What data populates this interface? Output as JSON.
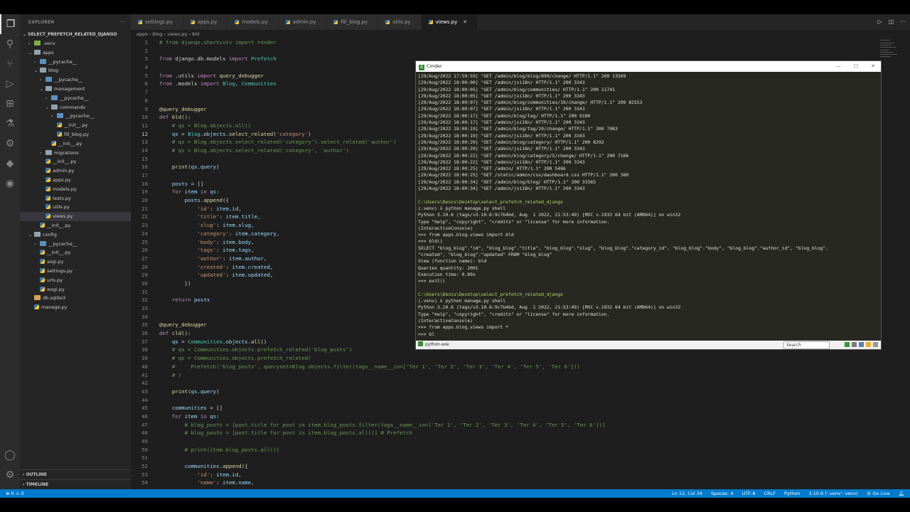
{
  "explorer": {
    "title": "EXPLORER",
    "project": "SELECT_PREFETCH_RELATED_DJANGO",
    "items": [
      {
        "label": ".venv",
        "indent": 1,
        "type": "venv",
        "chev": "›"
      },
      {
        "label": "apps",
        "indent": 1,
        "type": "folder",
        "chev": "⌄"
      },
      {
        "label": "__pycache__",
        "indent": 2,
        "type": "pyc",
        "chev": "›"
      },
      {
        "label": "blog",
        "indent": 2,
        "type": "folder",
        "chev": "⌄"
      },
      {
        "label": "__pycache__",
        "indent": 3,
        "type": "pyc",
        "chev": "›"
      },
      {
        "label": "management",
        "indent": 3,
        "type": "folder",
        "chev": "⌄"
      },
      {
        "label": "__pycache__",
        "indent": 4,
        "type": "pyc",
        "chev": "›"
      },
      {
        "label": "commands",
        "indent": 4,
        "type": "folder",
        "chev": "⌄"
      },
      {
        "label": "__pycache__",
        "indent": 5,
        "type": "pyc",
        "chev": "›"
      },
      {
        "label": "__init__.py",
        "indent": 5,
        "type": "py",
        "chev": ""
      },
      {
        "label": "fill_blog.py",
        "indent": 5,
        "type": "py",
        "chev": ""
      },
      {
        "label": "__init__.py",
        "indent": 4,
        "type": "py",
        "chev": ""
      },
      {
        "label": "migrations",
        "indent": 3,
        "type": "folder",
        "chev": "›"
      },
      {
        "label": "__init__.py",
        "indent": 3,
        "type": "py",
        "chev": ""
      },
      {
        "label": "admin.py",
        "indent": 3,
        "type": "py",
        "chev": ""
      },
      {
        "label": "apps.py",
        "indent": 3,
        "type": "py",
        "chev": ""
      },
      {
        "label": "models.py",
        "indent": 3,
        "type": "py",
        "chev": ""
      },
      {
        "label": "tests.py",
        "indent": 3,
        "type": "py",
        "chev": ""
      },
      {
        "label": "utils.py",
        "indent": 3,
        "type": "py",
        "chev": ""
      },
      {
        "label": "views.py",
        "indent": 3,
        "type": "py",
        "chev": "",
        "selected": true
      },
      {
        "label": "__init__.py",
        "indent": 2,
        "type": "py",
        "chev": ""
      },
      {
        "label": "config",
        "indent": 1,
        "type": "folder",
        "chev": "⌄"
      },
      {
        "label": "__pycache__",
        "indent": 2,
        "type": "pyc",
        "chev": "›"
      },
      {
        "label": "__init__.py",
        "indent": 2,
        "type": "py",
        "chev": ""
      },
      {
        "label": "asgi.py",
        "indent": 2,
        "type": "py",
        "chev": ""
      },
      {
        "label": "settings.py",
        "indent": 2,
        "type": "py",
        "chev": ""
      },
      {
        "label": "urls.py",
        "indent": 2,
        "type": "py",
        "chev": ""
      },
      {
        "label": "wsgi.py",
        "indent": 2,
        "type": "py",
        "chev": ""
      },
      {
        "label": "db.sqlite3",
        "indent": 1,
        "type": "db",
        "chev": ""
      },
      {
        "label": "manage.py",
        "indent": 1,
        "type": "py",
        "chev": ""
      }
    ],
    "outline": "OUTLINE",
    "timeline": "TIMELINE"
  },
  "tabs": [
    {
      "label": "settings.py",
      "active": false
    },
    {
      "label": "apps.py",
      "active": false
    },
    {
      "label": "models.py",
      "active": false
    },
    {
      "label": "admin.py",
      "active": false
    },
    {
      "label": "fill_blog.py",
      "active": false
    },
    {
      "label": "utils.py",
      "active": false
    },
    {
      "label": "views.py",
      "active": true
    }
  ],
  "breadcrumb": "apps › blog › views.py › bld",
  "code": [
    [
      [
        "cmt",
        "# from django.shortcuts import render"
      ]
    ],
    [],
    [
      [
        "kw",
        "from "
      ],
      [
        "code",
        "django.db.models "
      ],
      [
        "kw",
        "import "
      ],
      [
        "cls",
        "Prefetch"
      ]
    ],
    [],
    [
      [
        "kw",
        "from "
      ],
      [
        "code",
        ".utils "
      ],
      [
        "kw",
        "import "
      ],
      [
        "fn",
        "query_debugger"
      ]
    ],
    [
      [
        "kw",
        "from "
      ],
      [
        "code",
        ".models "
      ],
      [
        "kw",
        "import "
      ],
      [
        "cls",
        "Blog"
      ],
      [
        "code",
        ", "
      ],
      [
        "cls",
        "Communities"
      ]
    ],
    [],
    [],
    [
      [
        "dec",
        "@query_debugger"
      ]
    ],
    [
      [
        "kw",
        "def "
      ],
      [
        "fn",
        "bld"
      ],
      [
        "code",
        "():"
      ]
    ],
    [
      [
        "code",
        "    "
      ],
      [
        "cmt",
        "# qs = Blog.objects.all()"
      ]
    ],
    [
      [
        "code",
        "    "
      ],
      [
        "var",
        "qs"
      ],
      [
        "code",
        " = "
      ],
      [
        "cls",
        "Blog"
      ],
      [
        "code",
        "."
      ],
      [
        "var",
        "objects"
      ],
      [
        "code",
        "."
      ],
      [
        "fn",
        "select_related"
      ],
      [
        "code",
        "("
      ],
      [
        "str",
        "'category'"
      ],
      [
        "code",
        ")"
      ]
    ],
    [
      [
        "code",
        "    "
      ],
      [
        "cmt",
        "# qs = Blog.objects.select_related('category').select_related('author')"
      ]
    ],
    [
      [
        "code",
        "    "
      ],
      [
        "cmt",
        "# qs = Blog.objects.select_related('category', 'author')"
      ]
    ],
    [],
    [
      [
        "code",
        "    "
      ],
      [
        "fn",
        "print"
      ],
      [
        "code",
        "("
      ],
      [
        "var",
        "qs"
      ],
      [
        "code",
        "."
      ],
      [
        "var",
        "query"
      ],
      [
        "code",
        ")"
      ]
    ],
    [],
    [
      [
        "code",
        "    "
      ],
      [
        "var",
        "posts"
      ],
      [
        "code",
        " = []"
      ]
    ],
    [
      [
        "code",
        "    "
      ],
      [
        "kw",
        "for "
      ],
      [
        "var",
        "item"
      ],
      [
        "kw",
        " in "
      ],
      [
        "var",
        "qs"
      ],
      [
        "code",
        ":"
      ]
    ],
    [
      [
        "code",
        "        "
      ],
      [
        "var",
        "posts"
      ],
      [
        "code",
        "."
      ],
      [
        "fn",
        "append"
      ],
      [
        "code",
        "({"
      ]
    ],
    [
      [
        "code",
        "            "
      ],
      [
        "str",
        "'id'"
      ],
      [
        "code",
        ": "
      ],
      [
        "var",
        "item"
      ],
      [
        "code",
        "."
      ],
      [
        "var",
        "id"
      ],
      [
        "code",
        ","
      ]
    ],
    [
      [
        "code",
        "            "
      ],
      [
        "str",
        "'title'"
      ],
      [
        "code",
        ": "
      ],
      [
        "var",
        "item"
      ],
      [
        "code",
        "."
      ],
      [
        "var",
        "title"
      ],
      [
        "code",
        ","
      ]
    ],
    [
      [
        "code",
        "            "
      ],
      [
        "str",
        "'slug'"
      ],
      [
        "code",
        ": "
      ],
      [
        "var",
        "item"
      ],
      [
        "code",
        "."
      ],
      [
        "var",
        "slug"
      ],
      [
        "code",
        ","
      ]
    ],
    [
      [
        "code",
        "            "
      ],
      [
        "str",
        "'category'"
      ],
      [
        "code",
        ": "
      ],
      [
        "var",
        "item"
      ],
      [
        "code",
        "."
      ],
      [
        "var",
        "category"
      ],
      [
        "code",
        ","
      ]
    ],
    [
      [
        "code",
        "            "
      ],
      [
        "str",
        "'body'"
      ],
      [
        "code",
        ": "
      ],
      [
        "var",
        "item"
      ],
      [
        "code",
        "."
      ],
      [
        "var",
        "body"
      ],
      [
        "code",
        ","
      ]
    ],
    [
      [
        "code",
        "            "
      ],
      [
        "str",
        "'tags'"
      ],
      [
        "code",
        ": "
      ],
      [
        "var",
        "item"
      ],
      [
        "code",
        "."
      ],
      [
        "var",
        "tags"
      ],
      [
        "code",
        ","
      ]
    ],
    [
      [
        "code",
        "            "
      ],
      [
        "str",
        "'author'"
      ],
      [
        "code",
        ": "
      ],
      [
        "var",
        "item"
      ],
      [
        "code",
        "."
      ],
      [
        "var",
        "author"
      ],
      [
        "code",
        ","
      ]
    ],
    [
      [
        "code",
        "            "
      ],
      [
        "str",
        "'created'"
      ],
      [
        "code",
        ": "
      ],
      [
        "var",
        "item"
      ],
      [
        "code",
        "."
      ],
      [
        "var",
        "created"
      ],
      [
        "code",
        ","
      ]
    ],
    [
      [
        "code",
        "            "
      ],
      [
        "str",
        "'updated'"
      ],
      [
        "code",
        ": "
      ],
      [
        "var",
        "item"
      ],
      [
        "code",
        "."
      ],
      [
        "var",
        "updated"
      ],
      [
        "code",
        ","
      ]
    ],
    [
      [
        "code",
        "        })"
      ]
    ],
    [],
    [
      [
        "code",
        "    "
      ],
      [
        "kw",
        "return "
      ],
      [
        "var",
        "posts"
      ]
    ],
    [],
    [],
    [
      [
        "dec",
        "@query_debugger"
      ]
    ],
    [
      [
        "kw",
        "def "
      ],
      [
        "fn",
        "cld"
      ],
      [
        "code",
        "():"
      ]
    ],
    [
      [
        "code",
        "    "
      ],
      [
        "var",
        "qs"
      ],
      [
        "code",
        " = "
      ],
      [
        "cls",
        "Communities"
      ],
      [
        "code",
        "."
      ],
      [
        "var",
        "objects"
      ],
      [
        "code",
        "."
      ],
      [
        "fn",
        "all"
      ],
      [
        "code",
        "()"
      ]
    ],
    [
      [
        "code",
        "    "
      ],
      [
        "cmt",
        "# qs = Communities.objects.prefetch_related('blog_posts')"
      ]
    ],
    [
      [
        "code",
        "    "
      ],
      [
        "cmt",
        "# qs = Communities.objects.prefetch_related("
      ]
    ],
    [
      [
        "code",
        "    "
      ],
      [
        "cmt",
        "#     Prefetch('blog_posts', queryset=Blog.objects.filter(tags__name__in=['Ter 1', 'Ter 2', 'Ter 3', 'Ter 4', 'Ter 5', 'Ter 6']))"
      ]
    ],
    [
      [
        "code",
        "    "
      ],
      [
        "cmt",
        "# )"
      ]
    ],
    [],
    [
      [
        "code",
        "    "
      ],
      [
        "fn",
        "print"
      ],
      [
        "code",
        "("
      ],
      [
        "var",
        "qs"
      ],
      [
        "code",
        "."
      ],
      [
        "var",
        "query"
      ],
      [
        "code",
        ")"
      ]
    ],
    [],
    [
      [
        "code",
        "    "
      ],
      [
        "var",
        "communities"
      ],
      [
        "code",
        " = []"
      ]
    ],
    [
      [
        "code",
        "    "
      ],
      [
        "kw",
        "for "
      ],
      [
        "var",
        "item"
      ],
      [
        "kw",
        " in "
      ],
      [
        "var",
        "qs"
      ],
      [
        "code",
        ":"
      ]
    ],
    [
      [
        "code",
        "        "
      ],
      [
        "cmt",
        "# blog_posts = [post.title for post in item.blog_posts.filter(tags__name__in=['Ter 1', 'Ter 2', 'Ter 3', 'Ter 4', 'Ter 5', 'Ter 6'])]"
      ]
    ],
    [
      [
        "code",
        "        "
      ],
      [
        "cmt",
        "# blog_posts = [post.title for post in item.blog_posts.all()] # Prefetch"
      ]
    ],
    [],
    [
      [
        "code",
        "        "
      ],
      [
        "cmt",
        "# print(item.blog_posts.all())"
      ]
    ],
    [],
    [
      [
        "code",
        "        "
      ],
      [
        "var",
        "communities"
      ],
      [
        "code",
        "."
      ],
      [
        "fn",
        "append"
      ],
      [
        "code",
        "({"
      ]
    ],
    [
      [
        "code",
        "            "
      ],
      [
        "str",
        "'id'"
      ],
      [
        "code",
        ": "
      ],
      [
        "var",
        "item"
      ],
      [
        "code",
        "."
      ],
      [
        "var",
        "id"
      ],
      [
        "code",
        ","
      ]
    ],
    [
      [
        "code",
        "            "
      ],
      [
        "str",
        "'name'"
      ],
      [
        "code",
        ": "
      ],
      [
        "var",
        "item"
      ],
      [
        "code",
        "."
      ],
      [
        "var",
        "name"
      ],
      [
        "code",
        ","
      ]
    ]
  ],
  "current_line": 12,
  "cmder": {
    "title": "Cmder",
    "lines": [
      "[29/Aug/2022 17:59:59] \"GET /admin/blog/blog/899/change/ HTTP/1.1\" 200 13569",
      "[29/Aug/2022 18:00:00] \"GET /admin/jsi18n/ HTTP/1.1\" 200 3343",
      "[29/Aug/2022 18:00:05] \"GET /admin/blog/communities/ HTTP/1.1\" 200 11741",
      "[29/Aug/2022 18:00:05] \"GET /admin/jsi18n/ HTTP/1.1\" 200 3343",
      "[29/Aug/2022 18:00:07] \"GET /admin/blog/communities/19/change/ HTTP/1.1\" 200 82553",
      "[29/Aug/2022 18:00:07] \"GET /admin/jsi18n/ HTTP/1.1\" 200 3343",
      "[29/Aug/2022 18:00:17] \"GET /admin/blog/tag/ HTTP/1.1\" 200 9180",
      "[29/Aug/2022 18:00:17] \"GET /admin/jsi18n/ HTTP/1.1\" 200 3343",
      "[29/Aug/2022 18:00:19] \"GET /admin/blog/tag/10/change/ HTTP/1.1\" 200 7083",
      "[29/Aug/2022 18:00:19] \"GET /admin/jsi18n/ HTTP/1.1\" 200 3343",
      "[29/Aug/2022 18:00:20] \"GET /admin/blog/category/ HTTP/1.1\" 200 8292",
      "[29/Aug/2022 18:00:20] \"GET /admin/jsi18n/ HTTP/1.1\" 200 3343",
      "[29/Aug/2022 18:00:22] \"GET /admin/blog/category/5/change/ HTTP/1.1\" 200 7166",
      "[29/Aug/2022 18:00:22] \"GET /admin/jsi18n/ HTTP/1.1\" 200 3343",
      "[29/Aug/2022 18:00:25] \"GET /admin/ HTTP/1.1\" 200 5466",
      "[29/Aug/2022 18:00:25] \"GET /static/admin/css/dashboard.css HTTP/1.1\" 200 380",
      "[29/Aug/2022 18:00:34] \"GET /admin/blog/blog/ HTTP/1.1\" 200 31565",
      "[29/Aug/2022 18:00:34] \"GET /admin/jsi18n/ HTTP/1.1\" 200 3343",
      "",
      "C:\\Users\\Denis\\Desktop\\select_prefetch_related_django",
      "(.venv) λ python manage.py shell",
      "Python 3.10.6 (tags/v3.10.6:9c7b4bd, Aug  1 2022, 21:53:49) [MSC v.1932 64 bit (AMD64)] on win32",
      "Type \"help\", \"copyright\", \"credits\" or \"license\" for more information.",
      "(InteractiveConsole)",
      ">>> from apps.blog.views import bld",
      ">>> bld()",
      "SELECT \"blog_blog\".\"id\", \"blog_blog\".\"title\", \"blog_blog\".\"slug\", \"blog_blog\".\"category_id\", \"blog_blog\".\"body\", \"blog_blog\".\"author_id\", \"blog_blog\".",
      "\"created\", \"blog_blog\".\"updated\" FROM \"blog_blog\"",
      "View (function name): bld",
      "Queries quantity: 2001",
      "Execution time: 0.89s",
      ">>> exit()",
      "",
      "C:\\Users\\Denis\\Desktop\\select_prefetch_related_django",
      "(.venv) λ python manage.py shell",
      "Python 3.10.6 (tags/v3.10.6:9c7b4bd, Aug  1 2022, 21:53:49) [MSC v.1932 64 bit (AMD64)] on win32",
      "Type \"help\", \"copyright\", \"credits\" or \"license\" for more information.",
      "(InteractiveConsole)",
      ">>> from apps.blog.views import *",
      ">>> bl"
    ],
    "tab_label": "python.exe",
    "search_placeholder": "Search"
  },
  "status": {
    "errors": "⊗ 0 ⚠ 0",
    "position": "Ln 12, Col 34",
    "spaces": "Spaces: 4",
    "encoding": "UTF-8",
    "eol": "CRLF",
    "language": "Python",
    "interpreter": "3.10.6 ('.venv': venv)",
    "golive": "⦿ Go Live"
  },
  "colors": {
    "statusbar": "#007acc",
    "editor_bg": "#1e1e1e",
    "sidebar_bg": "#252526",
    "cmder_bg": "#272822"
  }
}
